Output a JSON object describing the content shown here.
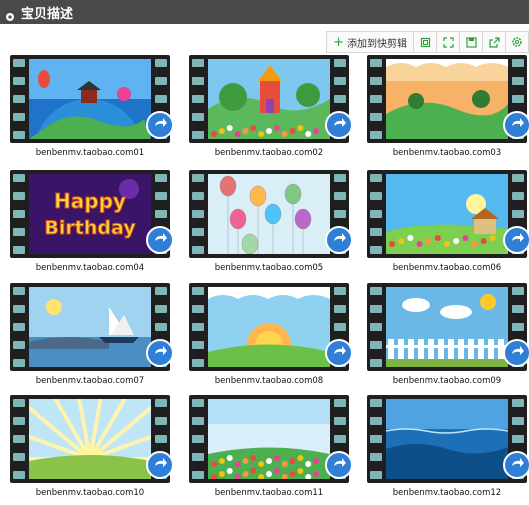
{
  "header": {
    "title": "宝贝描述",
    "icon": "gear-icon"
  },
  "toolbar": {
    "add_label": "添加到快剪辑",
    "icons": [
      "crop-icon",
      "expand-icon",
      "save-icon",
      "share-icon",
      "settings-icon"
    ]
  },
  "items": [
    {
      "label": "benbenmv.taobao.com01",
      "scene": "globe"
    },
    {
      "label": "benbenmv.taobao.com02",
      "scene": "castle"
    },
    {
      "label": "benbenmv.taobao.com03",
      "scene": "sunset-hills"
    },
    {
      "label": "benbenmv.taobao.com04",
      "scene": "birthday",
      "scene_text": [
        "Happy",
        "Birthday"
      ]
    },
    {
      "label": "benbenmv.taobao.com05",
      "scene": "balloons"
    },
    {
      "label": "benbenmv.taobao.com06",
      "scene": "house-flowers"
    },
    {
      "label": "benbenmv.taobao.com07",
      "scene": "sailboat"
    },
    {
      "label": "benbenmv.taobao.com08",
      "scene": "sunrise"
    },
    {
      "label": "benbenmv.taobao.com09",
      "scene": "fence-sun"
    },
    {
      "label": "benbenmv.taobao.com10",
      "scene": "sun-rays"
    },
    {
      "label": "benbenmv.taobao.com11",
      "scene": "flower-field"
    },
    {
      "label": "benbenmv.taobao.com12",
      "scene": "ocean"
    }
  ],
  "colors": {
    "header_bg": "#4a4a4a",
    "film": "#1f1f1f",
    "film_hole": "#7fb6b7",
    "badge": "#2f7fd6"
  }
}
